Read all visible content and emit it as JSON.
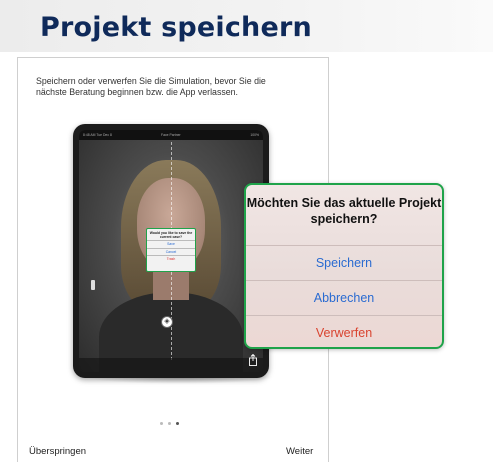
{
  "header": {
    "title": "Projekt speichern"
  },
  "intro": {
    "text": "Speichern oder verwerfen Sie die Simulation, bevor Sie die nächste Beratung beginnen bzw. die App verlassen."
  },
  "dialog": {
    "title": "Möchten Sie das aktuelle Projekt speichern?",
    "save_label": "Speichern",
    "cancel_label": "Abbrechen",
    "discard_label": "Verwerfen"
  },
  "mini_dialog": {
    "title": "Would you like to save the current case?",
    "save_label": "Save",
    "cancel_label": "Cancel",
    "discard_label": "Trash"
  },
  "ipad_topbar": {
    "left": "8:48 AM  Tue Dec 8",
    "center": "Face Partner",
    "right": "100%"
  },
  "pagination": {
    "count": 3,
    "active_index": 2
  },
  "footer": {
    "skip_label": "Überspringen",
    "next_label": "Weiter"
  },
  "colors": {
    "title": "#0f2a5a",
    "accent_border": "#1fa34a",
    "link_blue": "#2a6bd1",
    "destructive_red": "#d9432f"
  }
}
